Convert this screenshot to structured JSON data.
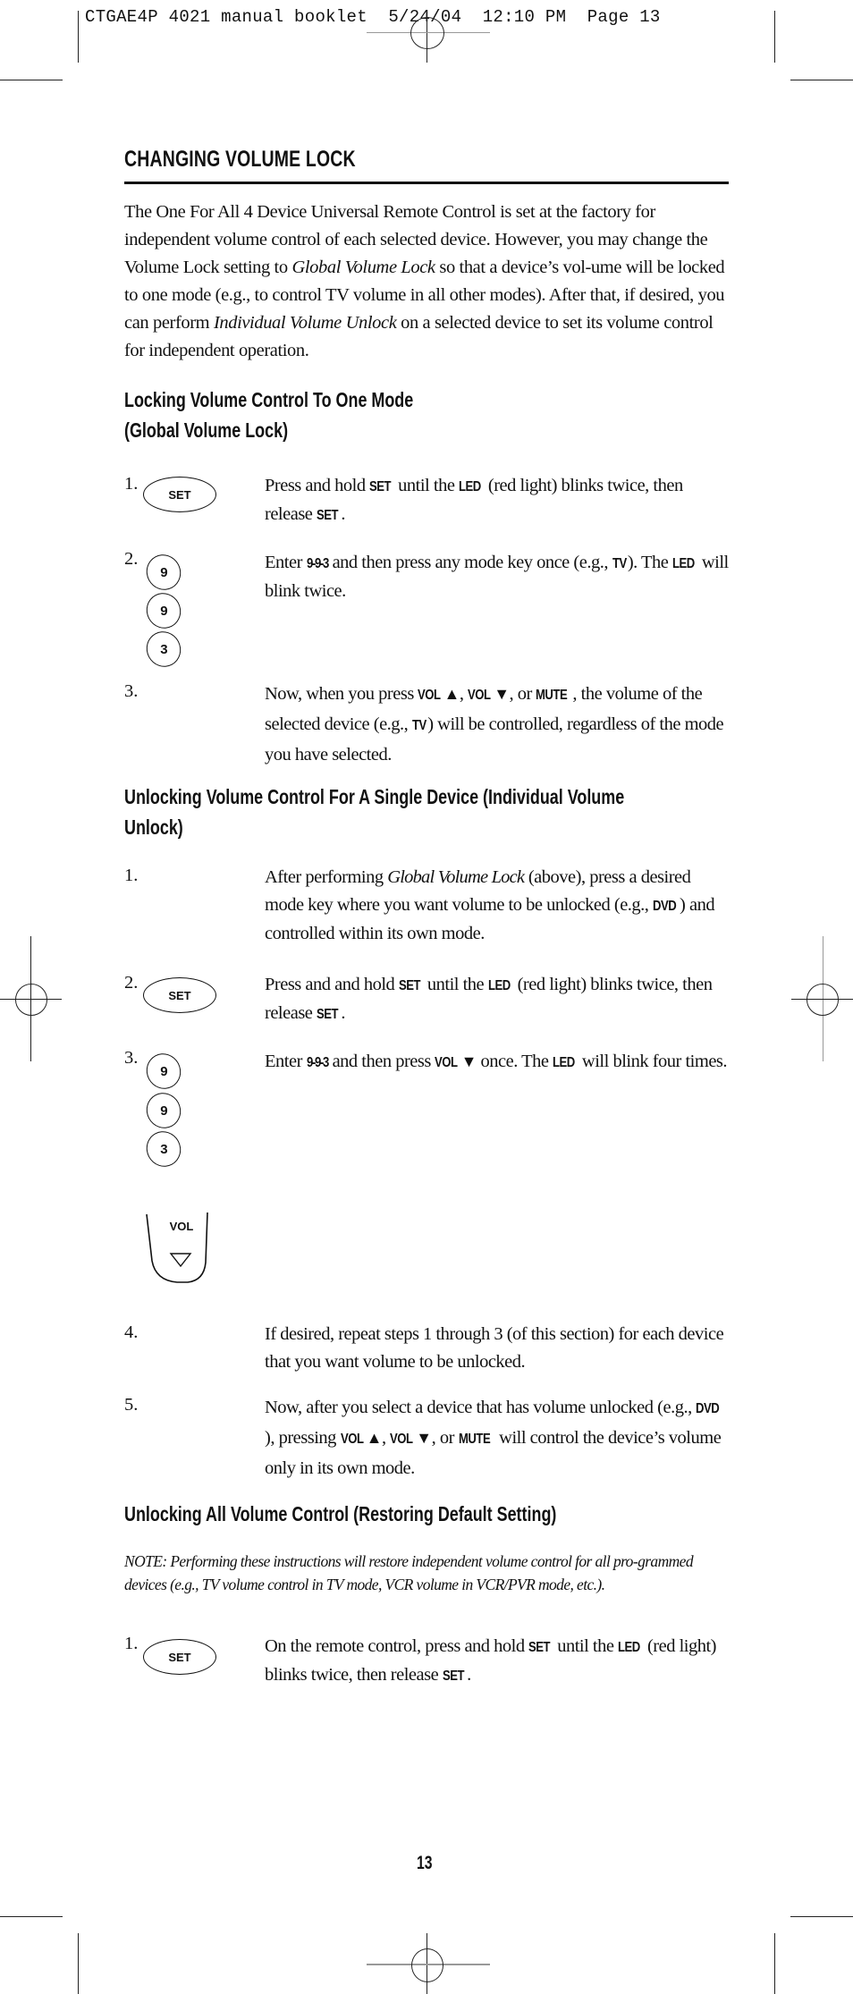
{
  "slug": {
    "filename": "CTGAE4P 4021 manual booklet",
    "date": "5/24/04",
    "time": "12:10 PM",
    "page_label": "Page 13"
  },
  "title": "CHANGING VOLUME LOCK",
  "intro": {
    "p1": "The One For All 4 Device Universal Remote Control is set at the factory for independent volume control of each selected device. However, you may change the Volume Lock setting to ",
    "em1": "Global Volume Lock",
    "p2": " so that a device’s vol-ume will be locked to one mode (e.g., to control TV volume in all other modes). After that, if desired, you can perform ",
    "em2": "Individual Volume Unlock",
    "p3": " on a selected device to set its volume control for independent operation."
  },
  "sections": [
    {
      "heading_line1": "Locking Volume Control To One Mode",
      "heading_line2": "(Global Volume Lock)",
      "steps": [
        {
          "num": "1.",
          "keys": [
            "SET"
          ],
          "text": {
            "a": "Press and hold ",
            "b1": "SET",
            "c": " until the ",
            "b2": "LED",
            "d": " (red light) blinks twice, then release ",
            "b3": "SET",
            "e": "."
          }
        },
        {
          "num": "2.",
          "keys": [
            "9",
            "9",
            "3"
          ],
          "text": {
            "a": "Enter ",
            "b1": "9",
            "s1": " - ",
            "b2": "9",
            "s2": " - ",
            "b3": "3",
            "c": " and then press any mode key once (e.g., ",
            "b4": "TV",
            "d": "). The ",
            "b5": "LED",
            "e": " will blink twice."
          }
        },
        {
          "num": "3.",
          "text": {
            "a": "Now, when you press ",
            "b1": "VOL",
            "up": "▲",
            "c": ", ",
            "b2": "VOL",
            "down": "▼",
            "d": ", or ",
            "b3": "MUTE",
            "e": ", the volume of the selected device (e.g., ",
            "b4": "TV",
            "f": ") will be controlled, regardless of the mode you have selected."
          }
        }
      ]
    },
    {
      "heading_line1": "Unlocking Volume Control For A Single Device (Individual Volume",
      "heading_line2": "Unlock)",
      "steps": [
        {
          "num": "1.",
          "text": {
            "a": "After performing ",
            "i1": "Global Volume Lock",
            "c": " (above), press a desired mode key where you want volume to be unlocked (e.g., ",
            "b1": "DVD",
            "d": ") and controlled within its own mode."
          }
        },
        {
          "num": "2.",
          "keys": [
            "SET"
          ],
          "text": {
            "a": "Press and and hold ",
            "b1": "SET",
            "c": " until the ",
            "b2": "LED",
            "d": " (red light) blinks twice, then release ",
            "b3": "SET",
            "e": "."
          }
        },
        {
          "num": "3.",
          "keys": [
            "9",
            "9",
            "3",
            "VOL"
          ],
          "text": {
            "a": "Enter ",
            "b1": "9",
            "s1": " - ",
            "b2": "9",
            "s2": " - ",
            "b3": "3",
            "c": " and then press ",
            "b4": "VOL",
            "down": "▼",
            "d": " once. The ",
            "b5": "LED",
            "e": " will blink four times."
          }
        },
        {
          "num": "4.",
          "text": {
            "a": "If desired, repeat steps 1 through 3 (of this section) for each device that you want volume to be unlocked."
          }
        },
        {
          "num": "5.",
          "text": {
            "a": "Now, after you select a device that has volume unlocked (e.g., ",
            "b1": "DVD",
            "c": "), pressing ",
            "b2": "VOL",
            "up": "▲",
            "d": ", ",
            "b3": "VOL",
            "down": "▼",
            "e": ", or ",
            "b4": "MUTE",
            "f": " will control the device’s volume only in its own mode."
          }
        }
      ]
    },
    {
      "heading_line1": "Unlocking All Volume Control (Restoring Default Setting)",
      "note": "NOTE: Performing these instructions will restore independent volume control  for all pro-grammed devices (e.g., TV volume control in TV mode, VCR volume in VCR/PVR mode, etc.).",
      "steps": [
        {
          "num": "1.",
          "keys": [
            "SET"
          ],
          "text": {
            "a": "On the remote control, press and hold ",
            "b1": "SET",
            "c": " until the ",
            "b2": "LED",
            "d": " (red light) blinks twice, then release ",
            "b3": "SET",
            "e": "."
          }
        }
      ]
    }
  ],
  "page_number": "13"
}
